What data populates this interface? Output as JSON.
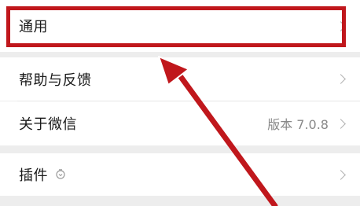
{
  "settings": {
    "items": [
      {
        "label": "通用"
      },
      {
        "label": "帮助与反馈"
      },
      {
        "label": "关于微信",
        "value": "版本 7.0.8"
      },
      {
        "label": "插件"
      }
    ]
  },
  "icons": {
    "chevron": "chevron-right-icon",
    "plugin": "plugin-bulb-icon"
  },
  "annotation": {
    "highlight_color": "#c0171c"
  }
}
